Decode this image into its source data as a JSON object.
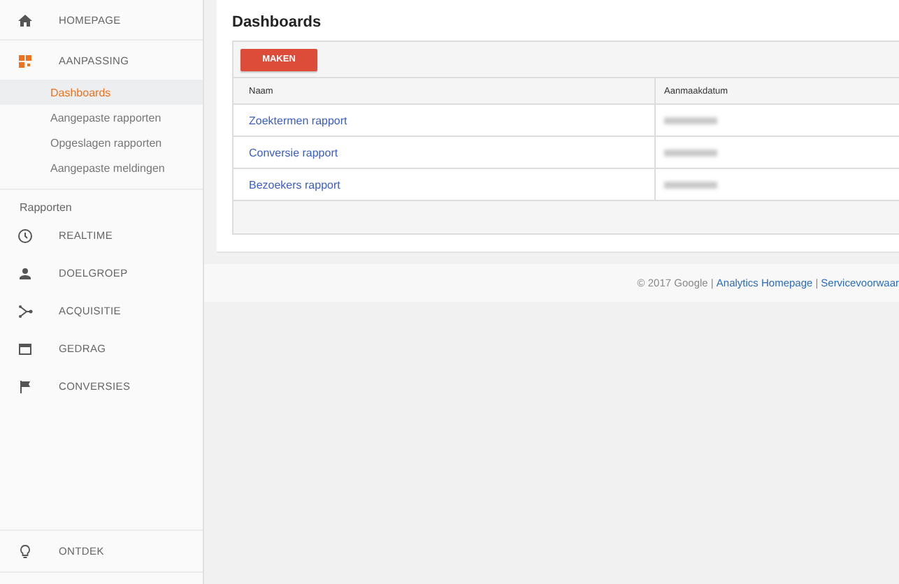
{
  "sidebar": {
    "top_items": [
      {
        "label": "HOMEPAGE",
        "selected": false
      },
      {
        "label": "AANPASSING",
        "selected": true,
        "children": [
          {
            "label": "Dashboards",
            "selected": true
          },
          {
            "label": "Aangepaste rapporten",
            "selected": false
          },
          {
            "label": "Opgeslagen rapporten",
            "selected": false
          },
          {
            "label": "Aangepaste meldingen",
            "selected": false
          }
        ]
      }
    ],
    "section_label": "Rapporten",
    "report_items": [
      {
        "label": "REALTIME",
        "selected": false
      },
      {
        "label": "DOELGROEP",
        "selected": false
      },
      {
        "label": "ACQUISITIE",
        "selected": false
      },
      {
        "label": "GEDRAG",
        "selected": false
      },
      {
        "label": "CONVERSIES",
        "selected": false
      }
    ],
    "bottom_item": {
      "label": "ONTDEK"
    }
  },
  "main": {
    "title": "Dashboards",
    "create_button": "MAKEN",
    "table": {
      "columns": [
        "Naam",
        "Aanmaakdatum"
      ],
      "rows": [
        {
          "name": "Zoektermen rapport"
        },
        {
          "name": "Conversie rapport"
        },
        {
          "name": "Bezoekers rapport"
        }
      ]
    }
  },
  "footer": {
    "copyright": "© 2017 Google |",
    "links": [
      {
        "label": "Analytics Homepage",
        "separator": "|"
      },
      {
        "label": "Servicevoorwaar"
      }
    ]
  }
}
